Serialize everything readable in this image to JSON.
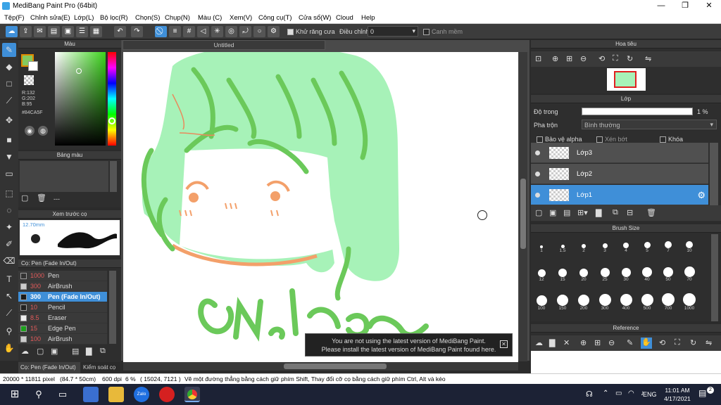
{
  "app": {
    "title": "MediBang Paint Pro (64bit)"
  },
  "menu": [
    "Tệp(F)",
    "Chỉnh sửa(E)",
    "Lớp(L)",
    "Bộ lọc(R)",
    "Chọn(S)",
    "Chụp(N)",
    "Màu (C)",
    "Xem(V)",
    "Công cụ(T)",
    "Cửa sổ(W)",
    "Cloud",
    "Help"
  ],
  "toolbar": {
    "antialias": "Khử răng cưa",
    "adjust_label": "Điều chỉnh",
    "adjust_value": "0",
    "snap": "Canh mềm"
  },
  "color_panel": {
    "title": "Màu",
    "r": "R:132",
    "g": "G:202",
    "b": "B:95",
    "hex": "#84CA5F",
    "primary": "#84CA5F"
  },
  "palette_panel": {
    "title": "Bảng màu",
    "info": "---"
  },
  "brush_preview": {
    "title": "Xem trước cọ",
    "size": "12.70mm"
  },
  "brush_panel": {
    "title": "Cọ: Pen (Fade In/Out)",
    "tab2": "Kiểm soát cọ",
    "items": [
      {
        "size": "1000",
        "name": "Pen",
        "color": "#333"
      },
      {
        "size": "300",
        "name": "AirBrush",
        "color": "#ccc"
      },
      {
        "size": "300",
        "name": "Pen (Fade In/Out)",
        "color": "#1a1a1a"
      },
      {
        "size": "10",
        "name": "Pencil",
        "color": "#222"
      },
      {
        "size": "8.5",
        "name": "Eraser",
        "color": "#eee"
      },
      {
        "size": "15",
        "name": "Edge Pen",
        "color": "#1ca01c"
      },
      {
        "size": "100",
        "name": "AirBrush",
        "color": "#ccc"
      }
    ]
  },
  "canvas": {
    "tab": "Untitled"
  },
  "notification": {
    "line1": "You are not using the latest version of MediBang Paint.",
    "line2": "Please install the latest version of MediBang Paint found here."
  },
  "navigator": {
    "title": "Hoa tiêu"
  },
  "layer_panel": {
    "title": "Lớp",
    "opacity_label": "Độ trong",
    "opacity_value": "1 %",
    "blend_label": "Pha trộn",
    "blend_value": "Bình thường",
    "protect_alpha": "Bảo vệ alpha",
    "clipping": "Xén bớt",
    "lock": "Khóa",
    "layers": [
      {
        "name": "Lớp3"
      },
      {
        "name": "Lớp2"
      },
      {
        "name": "Lớp1"
      }
    ]
  },
  "brush_size": {
    "title": "Brush Size",
    "values": [
      "1",
      "1.5",
      "2",
      "3",
      "4",
      "5",
      "7",
      "10",
      "12",
      "15",
      "20",
      "25",
      "30",
      "40",
      "50",
      "70",
      "100",
      "150",
      "200",
      "300",
      "400",
      "500",
      "700",
      "1000"
    ]
  },
  "reference": {
    "title": "Reference"
  },
  "status": {
    "dims": "20000 * 11811 pixel",
    "cm": "(84.7 * 50cm)",
    "dpi": "600 dpi",
    "zoom": "6 %",
    "coords": "( 15024, 7121 )",
    "hint": "Vẽ một đường thẳng bằng cách giữ phím Shift, Thay đổi cỡ cọ bằng cách giữ phím Ctrl, Alt và kéo"
  },
  "taskbar": {
    "lang": "ENG",
    "time": "11:01 AM",
    "date": "4/17/2021",
    "badge": "2",
    "zalo": "Zalo"
  }
}
